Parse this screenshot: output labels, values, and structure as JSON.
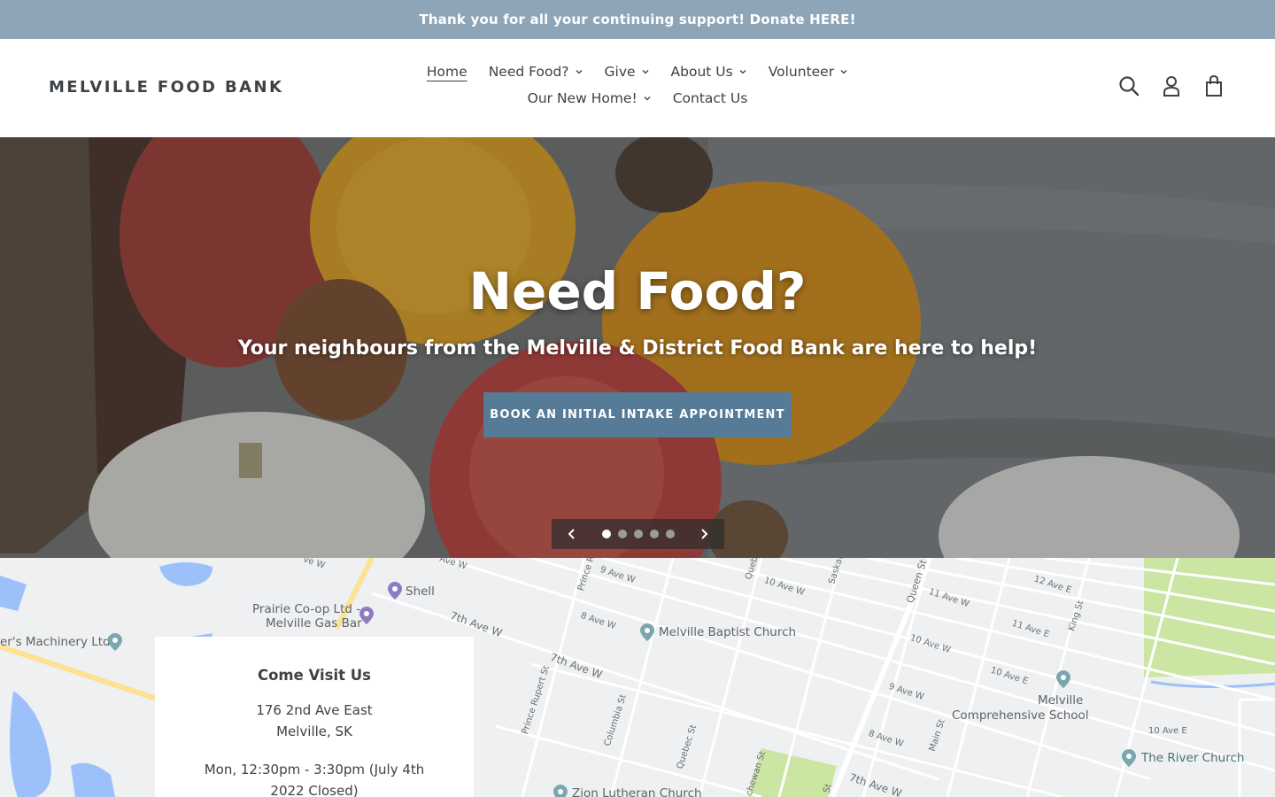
{
  "announcement": {
    "text": "Thank you for all your continuing support! Donate HERE!"
  },
  "header": {
    "logo": "MELVILLE FOOD BANK",
    "nav": [
      {
        "label": "Home",
        "active": true,
        "dropdown": false
      },
      {
        "label": "Need Food?",
        "dropdown": true
      },
      {
        "label": "Give",
        "dropdown": true
      },
      {
        "label": "About Us",
        "dropdown": true
      },
      {
        "label": "Volunteer",
        "dropdown": true
      },
      {
        "label": "Our New Home!",
        "dropdown": true
      },
      {
        "label": "Contact Us",
        "dropdown": false
      }
    ],
    "icons": [
      "search-icon",
      "account-icon",
      "cart-icon"
    ]
  },
  "hero": {
    "title": "Need Food?",
    "subtitle": "Your neighbours from the Melville & District Food Bank are here to help!",
    "button": "BOOK AN INITIAL INTAKE APPOINTMENT",
    "slide_count": 5,
    "active_slide": 1
  },
  "map": {
    "streets": {
      "s1": "7th Ave W",
      "s2": "7th Ave W",
      "s3": "9 Ave W",
      "s4": "8 Ave W",
      "s5": "10 Ave W",
      "s6": "11 Ave W",
      "s7": "12 Ave E",
      "s8": "11 Ave E",
      "s9": "10 Ave E",
      "s10": "10 Ave W",
      "s11": "9 Ave W",
      "s12": "8 Ave W",
      "s13": "7th Ave W",
      "s14": "10 Ave E",
      "s15": "Queen St",
      "s16": "Main St",
      "s17": "Quebec St",
      "s18": "Columbia St",
      "s19": "Prince Rupert St",
      "s20": "King St",
      "s21": "Prince R",
      "s22": "Queb",
      "s23": "Saskat",
      "s24": "chewan St",
      "s25": "St",
      "s26": "Ave W",
      "s27": "ve W"
    },
    "pois": {
      "shell": "Shell",
      "coop_line1": "Prairie Co-op Ltd -",
      "coop_line2": "Melville Gas Bar",
      "machinery": "er's Machinery Ltd",
      "baptist": "Melville Baptist Church",
      "school_line1": "Melville",
      "school_line2": "Comprehensive School",
      "river_church": "The River Church",
      "zion": "Zion Lutheran Church"
    },
    "colors": {
      "water": "#9cc0f9",
      "park": "#cbe6a3",
      "road": "#ffffff",
      "highway": "#fde293",
      "land": "#eef0f1"
    }
  },
  "visit": {
    "title": "Come Visit Us",
    "address_line1": "176 2nd Ave East",
    "address_line2": "Melville, SK",
    "hours": "Mon, 12:30pm - 3:30pm (July 4th 2022 Closed)"
  },
  "colors": {
    "announcement_bg": "#8ea5b7",
    "button_bg": "#557b97",
    "text": "#3d4246"
  }
}
